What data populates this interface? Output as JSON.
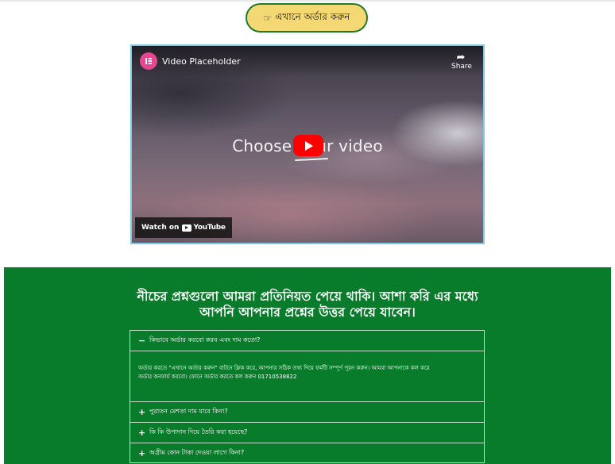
{
  "order_button": {
    "icon": "hand-pointing-icon",
    "label": "এখানে অর্ডার করুন"
  },
  "video": {
    "title": "Video Placeholder",
    "share_label": "Share",
    "center_text": "Choose your video",
    "watch_on_label": "Watch on",
    "youtube_label": "YouTube"
  },
  "faq": {
    "heading_line1": "নীচের প্রশ্নগুলো আমরা প্রতিনিয়ত পেয়ে থাকি। আশা করি এর মধ্যে",
    "heading_line2": "আপনি আপনার প্রশ্নের উত্তর পেয়ে যাবেন।",
    "items": [
      {
        "sign": "−",
        "question": "কিভাবে অর্ডার করবো করব এবং দাম কতো?",
        "expanded": true
      },
      {
        "sign": "+",
        "question": "পুরাতন মেশতা দাম যাবে কিনা?",
        "expanded": false
      },
      {
        "sign": "+",
        "question": "কি কি উপাদান দিয়ে তৈরি করা হয়েছে?",
        "expanded": false
      },
      {
        "sign": "+",
        "question": "অগ্রীম কোন টাকা দেওয়া লাগে কিনা?",
        "expanded": false
      }
    ],
    "answer_line1": "অর্ডার করতে \"এখানে অর্ডার করুন\" বাটনে ক্লিক করে, আপনার সঠিক তথ্য দিয়ে ফর্মটি সম্পূর্ণ পূরন করুন। আমরা আপনাকে কল করে",
    "answer_line2": "অর্ডার কনফার্ম করবো। ফোনে অর্ডার করতে কল করুন 01710538822"
  },
  "colors": {
    "brand_green": "#097c2b",
    "button_yellow": "#f3d873",
    "youtube_red": "#ff0000"
  }
}
